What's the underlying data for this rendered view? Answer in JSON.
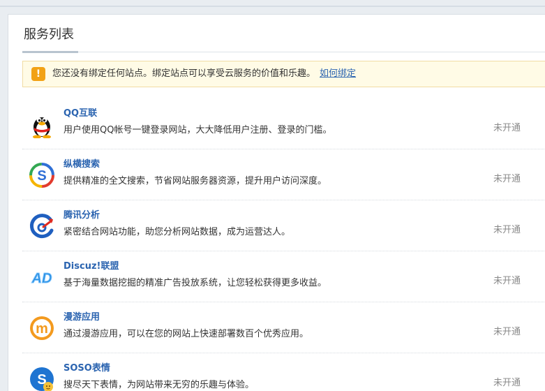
{
  "panel": {
    "title": "服务列表"
  },
  "notice": {
    "icon": "exclamation-icon",
    "text": "您还没有绑定任何站点。绑定站点可以享受云服务的价值和乐趣。",
    "link": "如何绑定"
  },
  "services": [
    {
      "name": "QQ互联",
      "desc": "用户使用QQ帐号一键登录网站，大大降低用户注册、登录的门槛。",
      "status": "未开通",
      "icon": "qq-penguin-icon"
    },
    {
      "name": "纵横搜索",
      "desc": "提供精准的全文搜索，节省网站服务器资源，提升用户访问深度。",
      "status": "未开通",
      "icon": "search-s-icon"
    },
    {
      "name": "腾讯分析",
      "desc": "紧密结合网站功能，助您分析网站数据，成为运营达人。",
      "status": "未开通",
      "icon": "analytics-icon"
    },
    {
      "name": "Discuz!联盟",
      "desc": "基于海量数据挖掘的精准广告投放系统，让您轻松获得更多收益。",
      "status": "未开通",
      "icon": "ad-icon"
    },
    {
      "name": "漫游应用",
      "desc": "通过漫游应用，可以在您的网站上快速部署数百个优秀应用。",
      "status": "未开通",
      "icon": "manyou-m-icon"
    },
    {
      "name": "SOSO表情",
      "desc": "搜尽天下表情，为网站带来无穷的乐趣与体验。",
      "status": "未开通",
      "icon": "soso-emoji-icon"
    }
  ],
  "colors": {
    "link": "#2b64b0",
    "notice_bg": "#fffbe6",
    "notice_icon": "#f2a215"
  }
}
